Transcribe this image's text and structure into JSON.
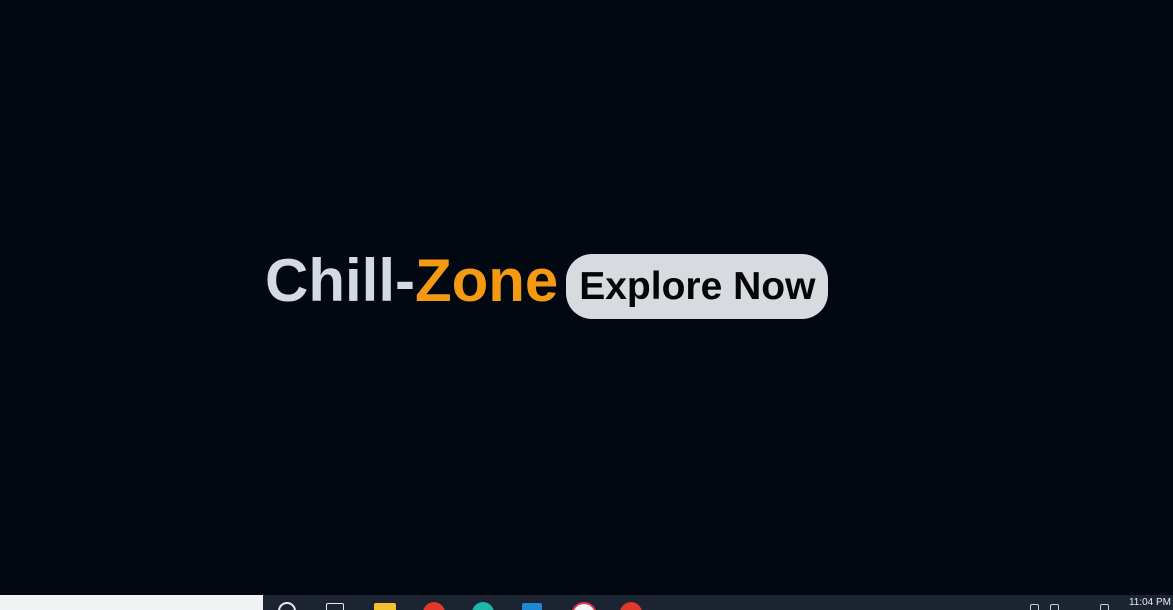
{
  "hero": {
    "brand_part1": "Chill-",
    "brand_part2": "Zone",
    "cta_label": "Explore Now"
  },
  "colors": {
    "background": "#010812",
    "brand_text": "#d6d9df",
    "brand_accent": "#f39a12",
    "button_bg": "#d7dadf",
    "button_text": "#050505"
  },
  "taskbar": {
    "clock_time": "11:04 PM",
    "icons": [
      "search-icon",
      "task-view-icon",
      "file-explorer-icon",
      "chrome-icon",
      "edge-icon",
      "vscode-icon",
      "paint-icon",
      "chrome-profile-icon"
    ]
  }
}
